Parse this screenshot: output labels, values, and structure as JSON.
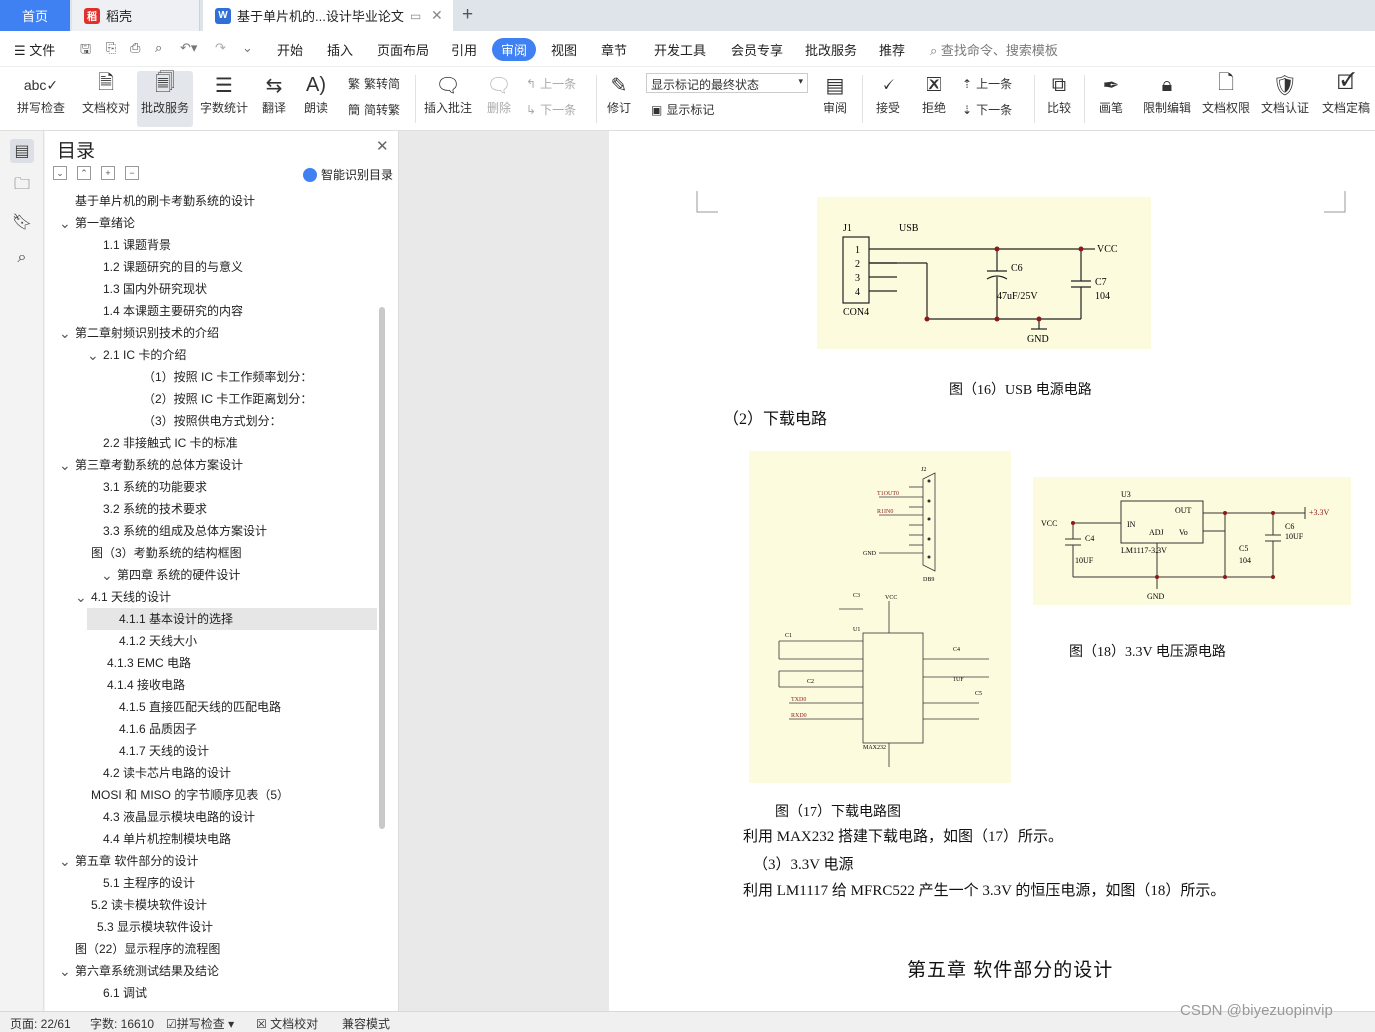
{
  "tabs": {
    "home": "首页",
    "doc1": "稻壳",
    "active": "基于单片机的...设计毕业论文"
  },
  "menu": {
    "file": "文件",
    "items": [
      "开始",
      "插入",
      "页面布局",
      "引用",
      "审阅",
      "视图",
      "章节",
      "开发工具",
      "会员专享",
      "批改服务",
      "推荐"
    ],
    "active_index": 4,
    "search": "查找命令、搜索模板"
  },
  "toolbar": {
    "spell": "拼写检查",
    "proof": "文档校对",
    "review_service": "批改服务",
    "word_count": "字数统计",
    "translate": "翻译",
    "read": "朗读",
    "to_trad": "繁转简",
    "to_simp": "简转繁",
    "insert_comment": "插入批注",
    "delete": "删除",
    "prev": "上一条",
    "next": "下一条",
    "revise": "修订",
    "markup_state": "显示标记的最终状态",
    "show_markup": "显示标记",
    "review": "审阅",
    "accept": "接受",
    "reject": "拒绝",
    "prev2": "上一条",
    "next2": "下一条",
    "compare": "比较",
    "pen": "画笔",
    "restrict": "限制编辑",
    "permission": "文档权限",
    "certify": "文档认证",
    "finalize": "文档定稿"
  },
  "toc": {
    "title": "目录",
    "smart": "智能识别目录",
    "items": [
      {
        "label": "基于单片机的刷卡考勤系统的设计",
        "indent": 30,
        "arrow": ""
      },
      {
        "label": "第一章绪论",
        "indent": 30,
        "arrow": "v"
      },
      {
        "label": "1.1 课题背景",
        "indent": 58,
        "arrow": ""
      },
      {
        "label": "1.2  课题研究的目的与意义",
        "indent": 58,
        "arrow": ""
      },
      {
        "label": "1.3 国内外研究现状",
        "indent": 58,
        "arrow": ""
      },
      {
        "label": "1.4 本课题主要研究的内容",
        "indent": 58,
        "arrow": ""
      },
      {
        "label": "第二章射频识别技术的介绍",
        "indent": 30,
        "arrow": "v"
      },
      {
        "label": "2.1 IC 卡的介绍",
        "indent": 58,
        "arrow": "v"
      },
      {
        "label": "（1）按照 IC 卡工作频率划分：",
        "indent": 98,
        "arrow": ""
      },
      {
        "label": "（2）按照 IC 卡工作距离划分：",
        "indent": 98,
        "arrow": ""
      },
      {
        "label": "（3）按照供电方式划分：",
        "indent": 98,
        "arrow": ""
      },
      {
        "label": "2.2  非接触式 IC  卡的标准",
        "indent": 58,
        "arrow": ""
      },
      {
        "label": "第三章考勤系统的总体方案设计",
        "indent": 30,
        "arrow": "v"
      },
      {
        "label": "3.1 系统的功能要求",
        "indent": 58,
        "arrow": ""
      },
      {
        "label": "3.2 系统的技术要求",
        "indent": 58,
        "arrow": ""
      },
      {
        "label": "3.3  系统的组成及总体方案设计",
        "indent": 58,
        "arrow": ""
      },
      {
        "label": "图（3）考勤系统的结构框图",
        "indent": 46,
        "arrow": ""
      },
      {
        "label": "第四章  系统的硬件设计",
        "indent": 72,
        "arrow": "v"
      },
      {
        "label": "4.1 天线的设计",
        "indent": 46,
        "arrow": "v"
      },
      {
        "label": "4.1.1 基本设计的选择",
        "indent": 74,
        "arrow": "",
        "hl": true
      },
      {
        "label": "4.1.2  天线大小",
        "indent": 74,
        "arrow": ""
      },
      {
        "label": "4.1.3 EMC  电路",
        "indent": 62,
        "arrow": ""
      },
      {
        "label": "4.1.4  接收电路",
        "indent": 62,
        "arrow": ""
      },
      {
        "label": "4.1.5 直接匹配天线的匹配电路",
        "indent": 74,
        "arrow": ""
      },
      {
        "label": "4.1.6 品质因子",
        "indent": 74,
        "arrow": ""
      },
      {
        "label": "4.1.7 天线的设计",
        "indent": 74,
        "arrow": ""
      },
      {
        "label": "4.2 读卡芯片电路的设计",
        "indent": 58,
        "arrow": ""
      },
      {
        "label": "MOSI 和 MISO 的字节顺序见表（5）",
        "indent": 46,
        "arrow": ""
      },
      {
        "label": "4.3 液晶显示模块电路的设计",
        "indent": 58,
        "arrow": ""
      },
      {
        "label": "4.4 单片机控制模块电路",
        "indent": 58,
        "arrow": ""
      },
      {
        "label": "第五章   软件部分的设计",
        "indent": 30,
        "arrow": "v"
      },
      {
        "label": "5.1 主程序的设计",
        "indent": 58,
        "arrow": ""
      },
      {
        "label": "5.2 读卡模块软件设计",
        "indent": 46,
        "arrow": ""
      },
      {
        "label": "5.3 显示模块软件设计",
        "indent": 52,
        "arrow": ""
      },
      {
        "label": "图（22）显示程序的流程图",
        "indent": 30,
        "arrow": ""
      },
      {
        "label": "第六章系统测试结果及结论",
        "indent": 30,
        "arrow": "v"
      },
      {
        "label": "6.1 调试",
        "indent": 58,
        "arrow": ""
      }
    ]
  },
  "document": {
    "fig16_caption": "图（16）USB 电源电路",
    "sec_download": "（2）下载电路",
    "fig17_caption": "图（17）下载电路图",
    "fig18_caption": "图（18）3.3V 电压源电路",
    "para_max232": "利用 MAX232 搭建下载电路，如图（17）所示。",
    "sec_33v": "（3）3.3V 电源",
    "para_lm1117": "利用 LM1117 给 MFRC522 产生一个 3.3V 的恒压电源，如图（18）所示。",
    "chapter5": "第五章    软件部分的设计"
  },
  "usb_fig": {
    "j1": "J1",
    "usb": "USB",
    "vcc": "VCC",
    "c6": "C6",
    "c6v": "47uF/25V",
    "c7": "C7",
    "c7v": "104",
    "con4": "CON4",
    "gnd": "GND",
    "pins": [
      "1",
      "2",
      "3",
      "4"
    ]
  },
  "dl_fig": {
    "j2": "J2",
    "db9": "DB9",
    "t1out": "T1OUT0",
    "r1in": "R1IN0",
    "gnd": "GND",
    "c3": "C3",
    "vcc": "VCC",
    "u1": "U1",
    "max": "MAX232",
    "txd": "TXD0",
    "rxd": "RXD0",
    "c1": "C1",
    "c2": "C2",
    "c4": "C4",
    "c5": "C5",
    "cap": "1UF"
  },
  "ps_fig": {
    "u3": "U3",
    "out": "OUT",
    "in": "IN",
    "vo": "Vo",
    "adj": "ADJ",
    "lm": "LM1117-3.3V",
    "vcc": "VCC",
    "c4": "C4",
    "c4v": "10UF",
    "c5": "C5",
    "c5v": "104",
    "c6": "C6",
    "c6v": "10UF",
    "p33": "+3.3V",
    "gnd": "GND"
  },
  "status": {
    "page": "页面: 22/61",
    "words": "字数: 16610",
    "spell": "拼写检查",
    "proof": "文档校对",
    "compat": "兼容模式"
  },
  "watermark": "CSDN @biyezuopinvip",
  "colors": {
    "accent": "#3f80f3",
    "figure_bg": "#fdfbdd",
    "wire_dark": "#222222",
    "wire_red": "#8b1a1a"
  }
}
